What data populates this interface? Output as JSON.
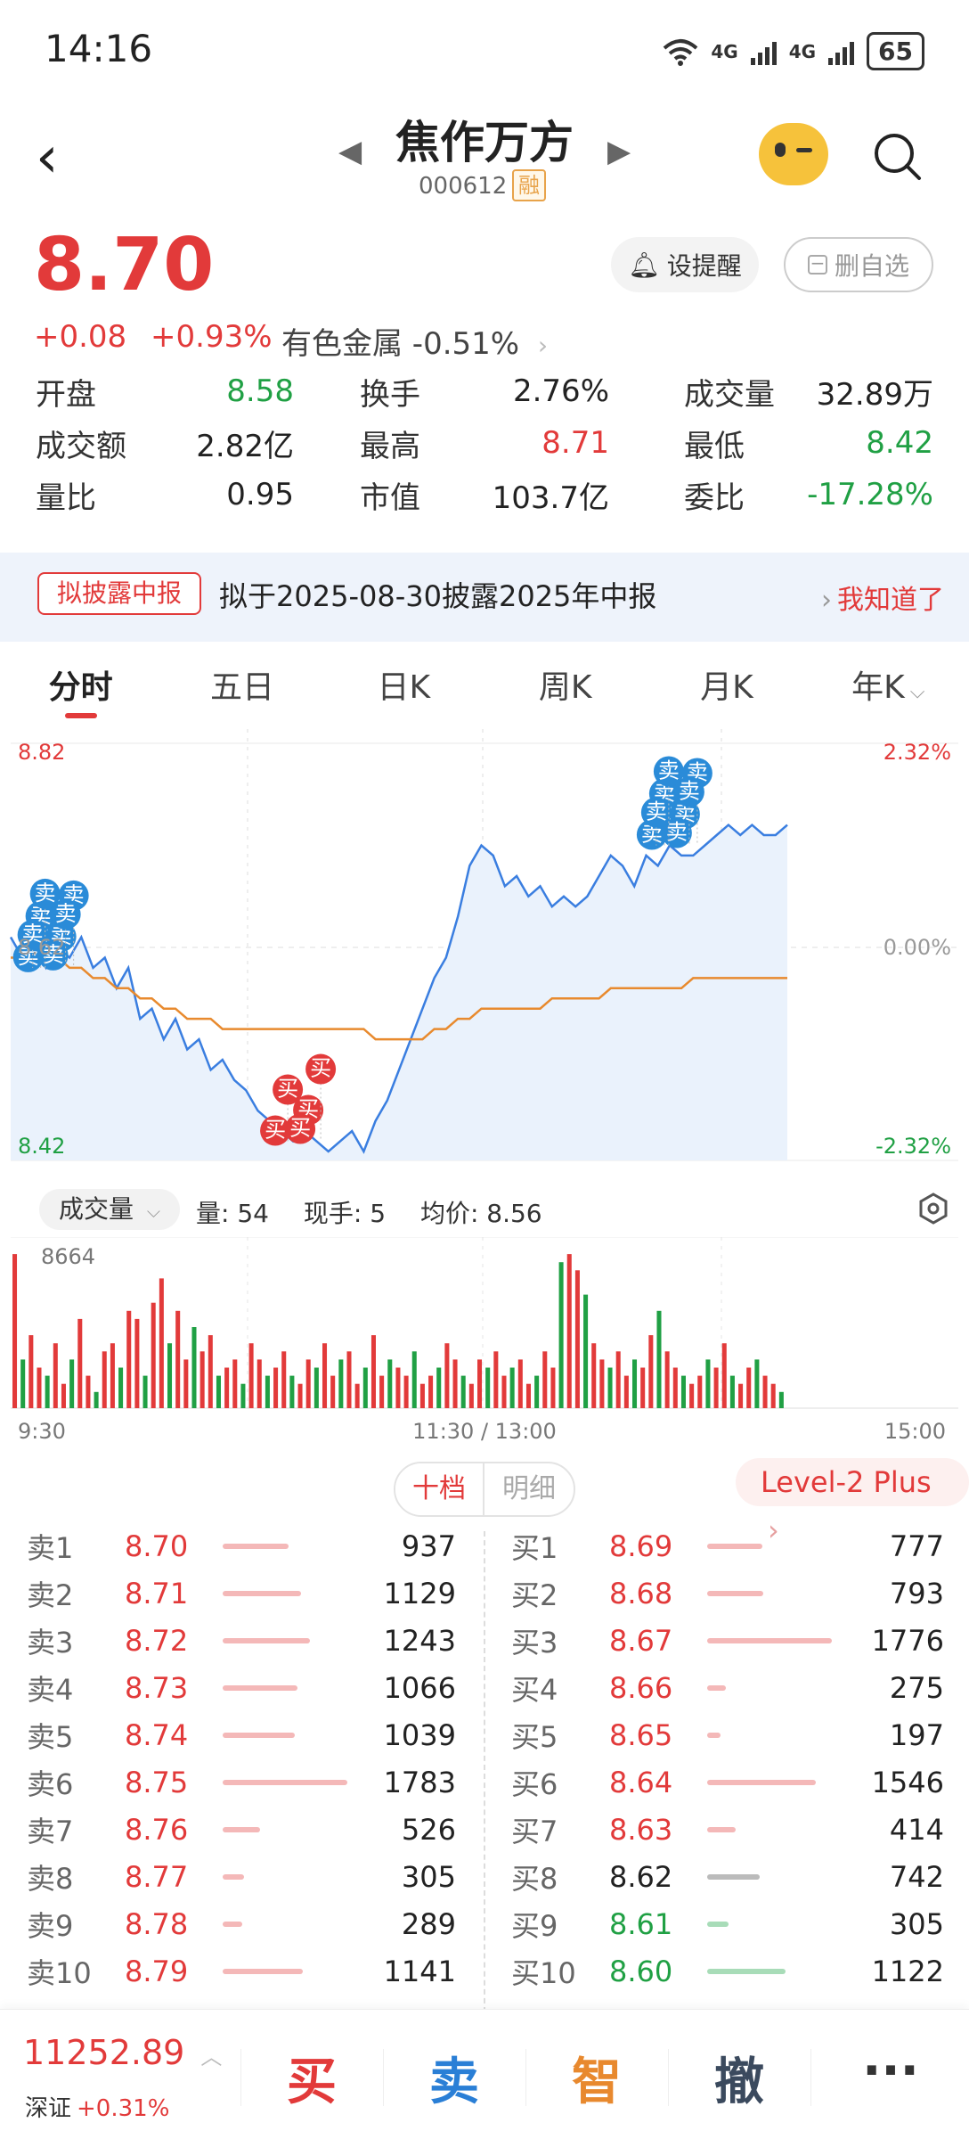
{
  "status_bar": {
    "time": "14:16",
    "network": "4G",
    "battery": "65"
  },
  "header": {
    "stock_name": "焦作万方",
    "stock_code": "000612",
    "margin_tag": "融"
  },
  "quote": {
    "price": "8.70",
    "change": "+0.08",
    "change_pct": "+0.93%",
    "sector": "有色金属 -0.51%",
    "alert_label": "设提醒",
    "delete_fav_label": "删自选"
  },
  "stats": [
    {
      "key": "开盘",
      "value": "8.58",
      "color": "green"
    },
    {
      "key": "换手",
      "value": "2.76%",
      "color": "black"
    },
    {
      "key": "成交量",
      "value": "32.89万",
      "color": "black"
    },
    {
      "key": "成交额",
      "value": "2.82亿",
      "color": "black"
    },
    {
      "key": "最高",
      "value": "8.71",
      "color": "red"
    },
    {
      "key": "最低",
      "value": "8.42",
      "color": "green"
    },
    {
      "key": "量比",
      "value": "0.95",
      "color": "black"
    },
    {
      "key": "市值",
      "value": "103.7亿",
      "color": "black"
    },
    {
      "key": "委比",
      "value": "-17.28%",
      "color": "green"
    }
  ],
  "notice": {
    "tag": "拟披露中报",
    "text": "拟于2025-08-30披露2025年中报",
    "ack": "我知道了"
  },
  "tabs": [
    "分时",
    "五日",
    "日K",
    "周K",
    "月K",
    "年K"
  ],
  "chart_data": {
    "type": "line",
    "y_left": {
      "max": "8.82",
      "mid": "8.62",
      "min": "8.42"
    },
    "y_right": {
      "max": "2.32%",
      "mid": "0.00%",
      "min": "-2.32%"
    },
    "x_labels": [
      "9:30",
      "11:30 / 13:00",
      "15:00"
    ],
    "price": [
      8.63,
      8.61,
      8.62,
      8.6,
      8.62,
      8.61,
      8.63,
      8.6,
      8.61,
      8.58,
      8.6,
      8.55,
      8.56,
      8.53,
      8.55,
      8.52,
      8.53,
      8.5,
      8.51,
      8.49,
      8.48,
      8.46,
      8.45,
      8.44,
      8.43,
      8.44,
      8.43,
      8.42,
      8.43,
      8.44,
      8.42,
      8.45,
      8.47,
      8.5,
      8.53,
      8.56,
      8.59,
      8.61,
      8.65,
      8.7,
      8.72,
      8.71,
      8.68,
      8.69,
      8.67,
      8.68,
      8.66,
      8.67,
      8.66,
      8.67,
      8.69,
      8.71,
      8.7,
      8.68,
      8.71,
      8.7,
      8.72,
      8.71,
      8.71,
      8.72,
      8.73,
      8.74,
      8.73,
      8.74,
      8.73,
      8.73,
      8.74
    ],
    "avg": [
      8.61,
      8.61,
      8.61,
      8.61,
      8.61,
      8.6,
      8.6,
      8.59,
      8.59,
      8.58,
      8.58,
      8.57,
      8.57,
      8.56,
      8.56,
      8.55,
      8.55,
      8.55,
      8.54,
      8.54,
      8.54,
      8.54,
      8.54,
      8.54,
      8.54,
      8.54,
      8.54,
      8.54,
      8.54,
      8.54,
      8.54,
      8.53,
      8.53,
      8.53,
      8.53,
      8.53,
      8.54,
      8.54,
      8.55,
      8.55,
      8.56,
      8.56,
      8.56,
      8.56,
      8.56,
      8.56,
      8.57,
      8.57,
      8.57,
      8.57,
      8.57,
      8.58,
      8.58,
      8.58,
      8.58,
      8.58,
      8.58,
      8.58,
      8.59,
      8.59,
      8.59,
      8.59,
      8.59,
      8.59,
      8.59,
      8.59,
      8.59
    ],
    "volume_axis_max": "8664",
    "volume_series": [
      95,
      30,
      45,
      25,
      20,
      40,
      15,
      30,
      55,
      20,
      10,
      35,
      40,
      25,
      60,
      55,
      20,
      65,
      80,
      40,
      60,
      30,
      50,
      35,
      45,
      20,
      25,
      30,
      15,
      40,
      30,
      20,
      25,
      35,
      20,
      15,
      30,
      25,
      40,
      20,
      30,
      35,
      15,
      25,
      45,
      20,
      30,
      25,
      20,
      35,
      15,
      20,
      25,
      40,
      30,
      20,
      15,
      30,
      25,
      35,
      20,
      25,
      30,
      15,
      20,
      35,
      25,
      90,
      95,
      85,
      70,
      40,
      30,
      25,
      35,
      20,
      30,
      25,
      45,
      60,
      35,
      25,
      20,
      15,
      20,
      30,
      25,
      40,
      20,
      15,
      25,
      30,
      20,
      15,
      10
    ],
    "volume_colors": "rg",
    "trade_markers": [
      {
        "type": "卖",
        "count": 9,
        "side": "sell",
        "time_index": 3
      },
      {
        "type": "买",
        "count": 5,
        "side": "buy",
        "time_index": 24
      },
      {
        "type": "卖",
        "count": 10,
        "side": "sell",
        "time_index": 56
      }
    ],
    "colors": {
      "price": "#3a7ee0",
      "avg": "#e88a2e",
      "up": "#e23a3a",
      "down": "#20a044"
    }
  },
  "volume_bar": {
    "selector": "成交量",
    "qty": "量: 54",
    "hand": "现手: 5",
    "avg_price": "均价: 8.56"
  },
  "book": {
    "tab_active": "十档",
    "tab_inactive": "明细",
    "level2": "Level-2 Plus",
    "asks": [
      {
        "label": "卖1",
        "price": "8.70",
        "vol": "937",
        "color": "red",
        "w": 0.53
      },
      {
        "label": "卖2",
        "price": "8.71",
        "vol": "1129",
        "color": "red",
        "w": 0.63
      },
      {
        "label": "卖3",
        "price": "8.72",
        "vol": "1243",
        "color": "red",
        "w": 0.7
      },
      {
        "label": "卖4",
        "price": "8.73",
        "vol": "1066",
        "color": "red",
        "w": 0.6
      },
      {
        "label": "卖5",
        "price": "8.74",
        "vol": "1039",
        "color": "red",
        "w": 0.58
      },
      {
        "label": "卖6",
        "price": "8.75",
        "vol": "1783",
        "color": "red",
        "w": 1.0
      },
      {
        "label": "卖7",
        "price": "8.76",
        "vol": "526",
        "color": "red",
        "w": 0.3
      },
      {
        "label": "卖8",
        "price": "8.77",
        "vol": "305",
        "color": "red",
        "w": 0.17
      },
      {
        "label": "卖9",
        "price": "8.78",
        "vol": "289",
        "color": "red",
        "w": 0.16
      },
      {
        "label": "卖10",
        "price": "8.79",
        "vol": "1141",
        "color": "red",
        "w": 0.64
      }
    ],
    "bids": [
      {
        "label": "买1",
        "price": "8.69",
        "vol": "777",
        "color": "red",
        "w": 0.44
      },
      {
        "label": "买2",
        "price": "8.68",
        "vol": "793",
        "color": "red",
        "w": 0.45
      },
      {
        "label": "买3",
        "price": "8.67",
        "vol": "1776",
        "color": "red",
        "w": 1.0
      },
      {
        "label": "买4",
        "price": "8.66",
        "vol": "275",
        "color": "red",
        "w": 0.15
      },
      {
        "label": "买5",
        "price": "8.65",
        "vol": "197",
        "color": "red",
        "w": 0.11
      },
      {
        "label": "买6",
        "price": "8.64",
        "vol": "1546",
        "color": "red",
        "w": 0.87
      },
      {
        "label": "买7",
        "price": "8.63",
        "vol": "414",
        "color": "red",
        "w": 0.23
      },
      {
        "label": "买8",
        "price": "8.62",
        "vol": "742",
        "color": "gray",
        "w": 0.42
      },
      {
        "label": "买9",
        "price": "8.61",
        "vol": "305",
        "color": "green",
        "w": 0.17
      },
      {
        "label": "买10",
        "price": "8.60",
        "vol": "1122",
        "color": "green",
        "w": 0.63
      }
    ]
  },
  "bottom": {
    "index_value": "11252.89",
    "index_name": "深证",
    "index_change": "+0.31%",
    "buy": "买",
    "sell": "卖",
    "smart": "智",
    "cancel": "撤",
    "more": "···"
  }
}
